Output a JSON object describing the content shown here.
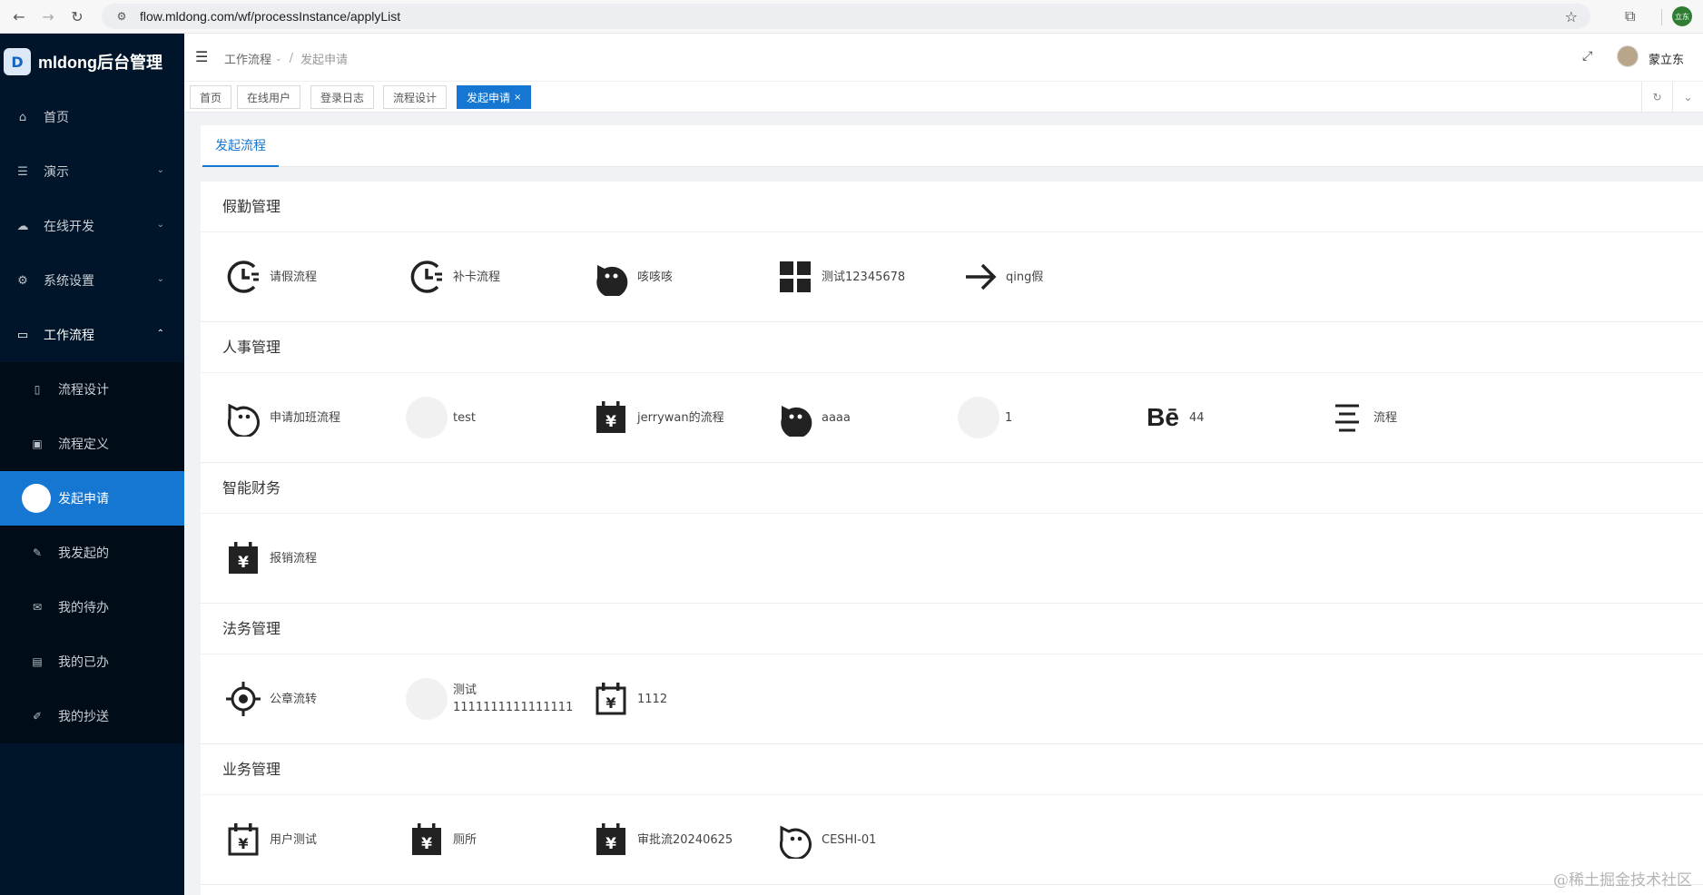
{
  "browser": {
    "url": "flow.mldong.com/wf/processInstance/applyList",
    "profile_label": "立东"
  },
  "sidebar": {
    "logo_text": "mldong后台管理",
    "items": [
      {
        "label": "首页",
        "icon": "home-icon"
      },
      {
        "label": "演示",
        "icon": "list-icon"
      },
      {
        "label": "在线开发",
        "icon": "cloud-icon"
      },
      {
        "label": "系统设置",
        "icon": "gear-icon"
      },
      {
        "label": "工作流程",
        "icon": "laptop-icon"
      }
    ],
    "submenu": [
      {
        "label": "流程设计",
        "icon": "file-icon"
      },
      {
        "label": "流程定义",
        "icon": "image-icon"
      },
      {
        "label": "发起申请",
        "icon": "circle-icon",
        "active": true
      },
      {
        "label": "我发起的",
        "icon": "edit-icon"
      },
      {
        "label": "我的待办",
        "icon": "mail-icon"
      },
      {
        "label": "我的已办",
        "icon": "book-icon"
      },
      {
        "label": "我的抄送",
        "icon": "pen-icon"
      }
    ]
  },
  "header": {
    "breadcrumb_parent": "工作流程",
    "breadcrumb_sep": "/",
    "breadcrumb_current": "发起申请",
    "username": "蒙立东"
  },
  "tabs": [
    {
      "label": "首页"
    },
    {
      "label": "在线用户"
    },
    {
      "label": "登录日志"
    },
    {
      "label": "流程设计"
    },
    {
      "label": "发起申请",
      "active": true,
      "close": "×"
    }
  ],
  "content": {
    "inner_tab": "发起流程",
    "groups": [
      {
        "title": "假勤管理",
        "items": [
          {
            "label": "请假流程",
            "icon": "clock-icon"
          },
          {
            "label": "补卡流程",
            "icon": "clock-icon"
          },
          {
            "label": "咳咳咳",
            "icon": "face-filled-icon"
          },
          {
            "label": "测试12345678",
            "icon": "grid-icon"
          },
          {
            "label": "qing假",
            "icon": "arrow-right-icon"
          }
        ]
      },
      {
        "title": "人事管理",
        "items": [
          {
            "label": "申请加班流程",
            "icon": "face-outline-icon"
          },
          {
            "label": "test",
            "icon": "empty-circle-icon"
          },
          {
            "label": "jerrywan的流程",
            "icon": "calendar-yen-filled-icon"
          },
          {
            "label": "aaaa",
            "icon": "face-filled-icon"
          },
          {
            "label": "1",
            "icon": "empty-circle-icon"
          },
          {
            "label": "44",
            "icon": "behance-icon",
            "icon_text": "Bē"
          },
          {
            "label": "流程",
            "icon": "menu-lines-icon"
          }
        ]
      },
      {
        "title": "智能财务",
        "items": [
          {
            "label": "报销流程",
            "icon": "calendar-yen-filled-icon"
          }
        ]
      },
      {
        "title": "法务管理",
        "items": [
          {
            "label": "公章流转",
            "icon": "target-icon"
          },
          {
            "label": "测试",
            "label2": "1111111111111111",
            "icon": "empty-circle-icon"
          },
          {
            "label": "1112",
            "icon": "calendar-yen-outline-icon"
          }
        ]
      },
      {
        "title": "业务管理",
        "items": [
          {
            "label": "用户测试",
            "icon": "calendar-yen-outline-icon"
          },
          {
            "label": "厕所",
            "icon": "calendar-yen-filled-icon"
          },
          {
            "label": "审批流20240625",
            "icon": "calendar-yen-filled-icon"
          },
          {
            "label": "CESHI-01",
            "icon": "face-outline-icon"
          }
        ]
      }
    ]
  },
  "watermark": "@稀土掘金技术社区"
}
